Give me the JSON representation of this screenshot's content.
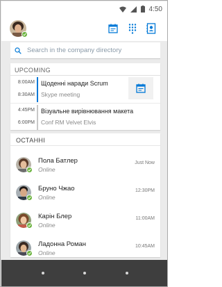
{
  "status_bar": {
    "time": "4:50"
  },
  "header": {
    "avatar_icon": "user-avatar",
    "icons": [
      "calendar-icon",
      "dialpad-icon",
      "contacts-icon"
    ]
  },
  "search": {
    "placeholder": "Search in the company directory"
  },
  "upcoming": {
    "title": "UPCOMING",
    "meetings": [
      {
        "start": "8:00AM",
        "end": "8:30AM",
        "title": "Щоденні наради Scrum",
        "subtitle": "Skype meeting",
        "accent": "#0078d7"
      },
      {
        "start": "4:45PM",
        "end": "6:00PM",
        "title": "Візуальне вирівнювання макета",
        "subtitle": "Conf RM Velvet Elvis",
        "accent": "#c8c8c8"
      }
    ]
  },
  "recent": {
    "title": "ОСТАННІ",
    "contacts": [
      {
        "name": "Пола Батлер",
        "status": "Online",
        "time": "Just Now"
      },
      {
        "name": "Бруно Чжао",
        "status": "Online",
        "time": "12:30PM"
      },
      {
        "name": "Карін Блер",
        "status": "Online",
        "time": "11:00AM"
      },
      {
        "name": "Ладонна Роман",
        "status": "Online",
        "time": "10:45AM"
      }
    ]
  },
  "colors": {
    "accent": "#0078d7",
    "presence": "#6cb33f",
    "navbar": "#3e3e3e"
  }
}
